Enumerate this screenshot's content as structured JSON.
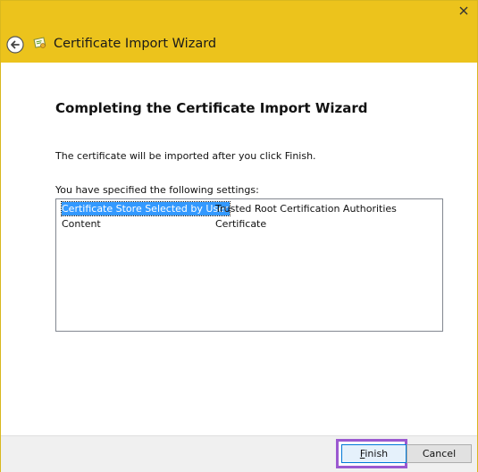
{
  "window": {
    "title": "Certificate Import Wizard"
  },
  "main": {
    "heading": "Completing the Certificate Import Wizard",
    "description": "The certificate will be imported after you click Finish.",
    "settings_label": "You have specified the following settings:",
    "settings": [
      {
        "key": "Certificate Store Selected by User",
        "value": "Trusted Root Certification Authorities",
        "selected": true
      },
      {
        "key": "Content",
        "value": "Certificate",
        "selected": false
      }
    ]
  },
  "footer": {
    "finish_label": "Finish",
    "cancel_label": "Cancel"
  },
  "colors": {
    "titlebar": "#ecc31c",
    "selection": "#3399ff",
    "highlight_frame": "#9b59d0"
  }
}
